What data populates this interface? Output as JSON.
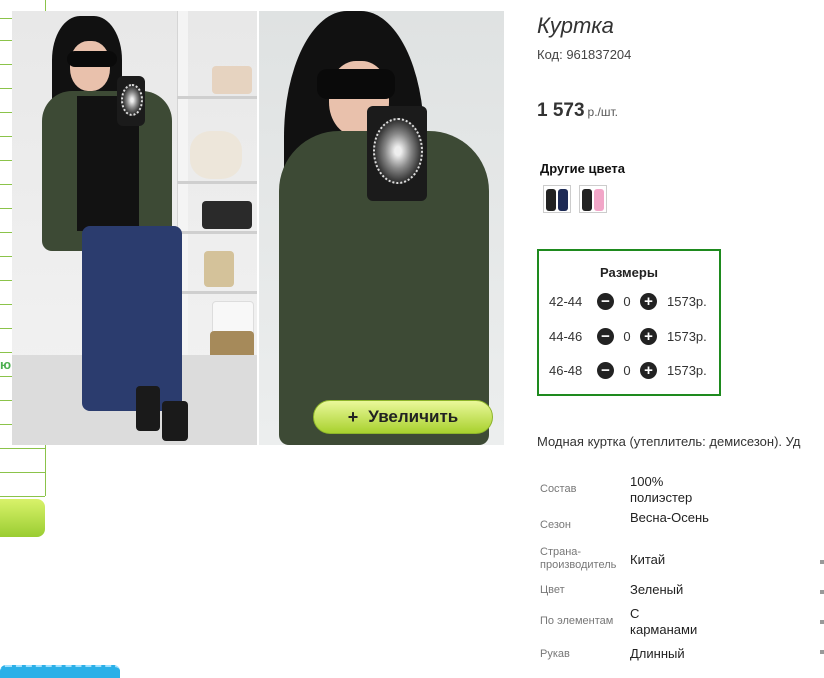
{
  "product": {
    "title": "Куртка",
    "code": "Код: 961837204",
    "price": "1 573",
    "price_unit": "р./шт.",
    "zoom_label": "Увеличить",
    "zoom_plus": "+",
    "other_colors_label": "Другие цвета",
    "description": "Модная куртка (утеплитель: демисезон). Уд"
  },
  "sidebar": {
    "green_text": "ю"
  },
  "sizes": {
    "title": "Размеры",
    "rows": [
      {
        "size": "42-44",
        "qty": "0",
        "price": "1573р."
      },
      {
        "size": "44-46",
        "qty": "0",
        "price": "1573р."
      },
      {
        "size": "46-48",
        "qty": "0",
        "price": "1573р."
      }
    ],
    "minus": "−",
    "plus": "+"
  },
  "properties": [
    {
      "label": "Состав",
      "value": "100% полиэстер"
    },
    {
      "label": "Сезон",
      "value": "Весна-Осень"
    },
    {
      "label": "Страна-производитель",
      "value": "Китай"
    },
    {
      "label": "Цвет",
      "value": "Зеленый"
    },
    {
      "label": "По элементам",
      "value": "С карманами"
    },
    {
      "label": "Рукав",
      "value": "Длинный"
    }
  ],
  "colors": {
    "accent_green": "#1e8a1e",
    "button_green": "#a8d12e",
    "jacket_olive": "#3d4a35"
  }
}
